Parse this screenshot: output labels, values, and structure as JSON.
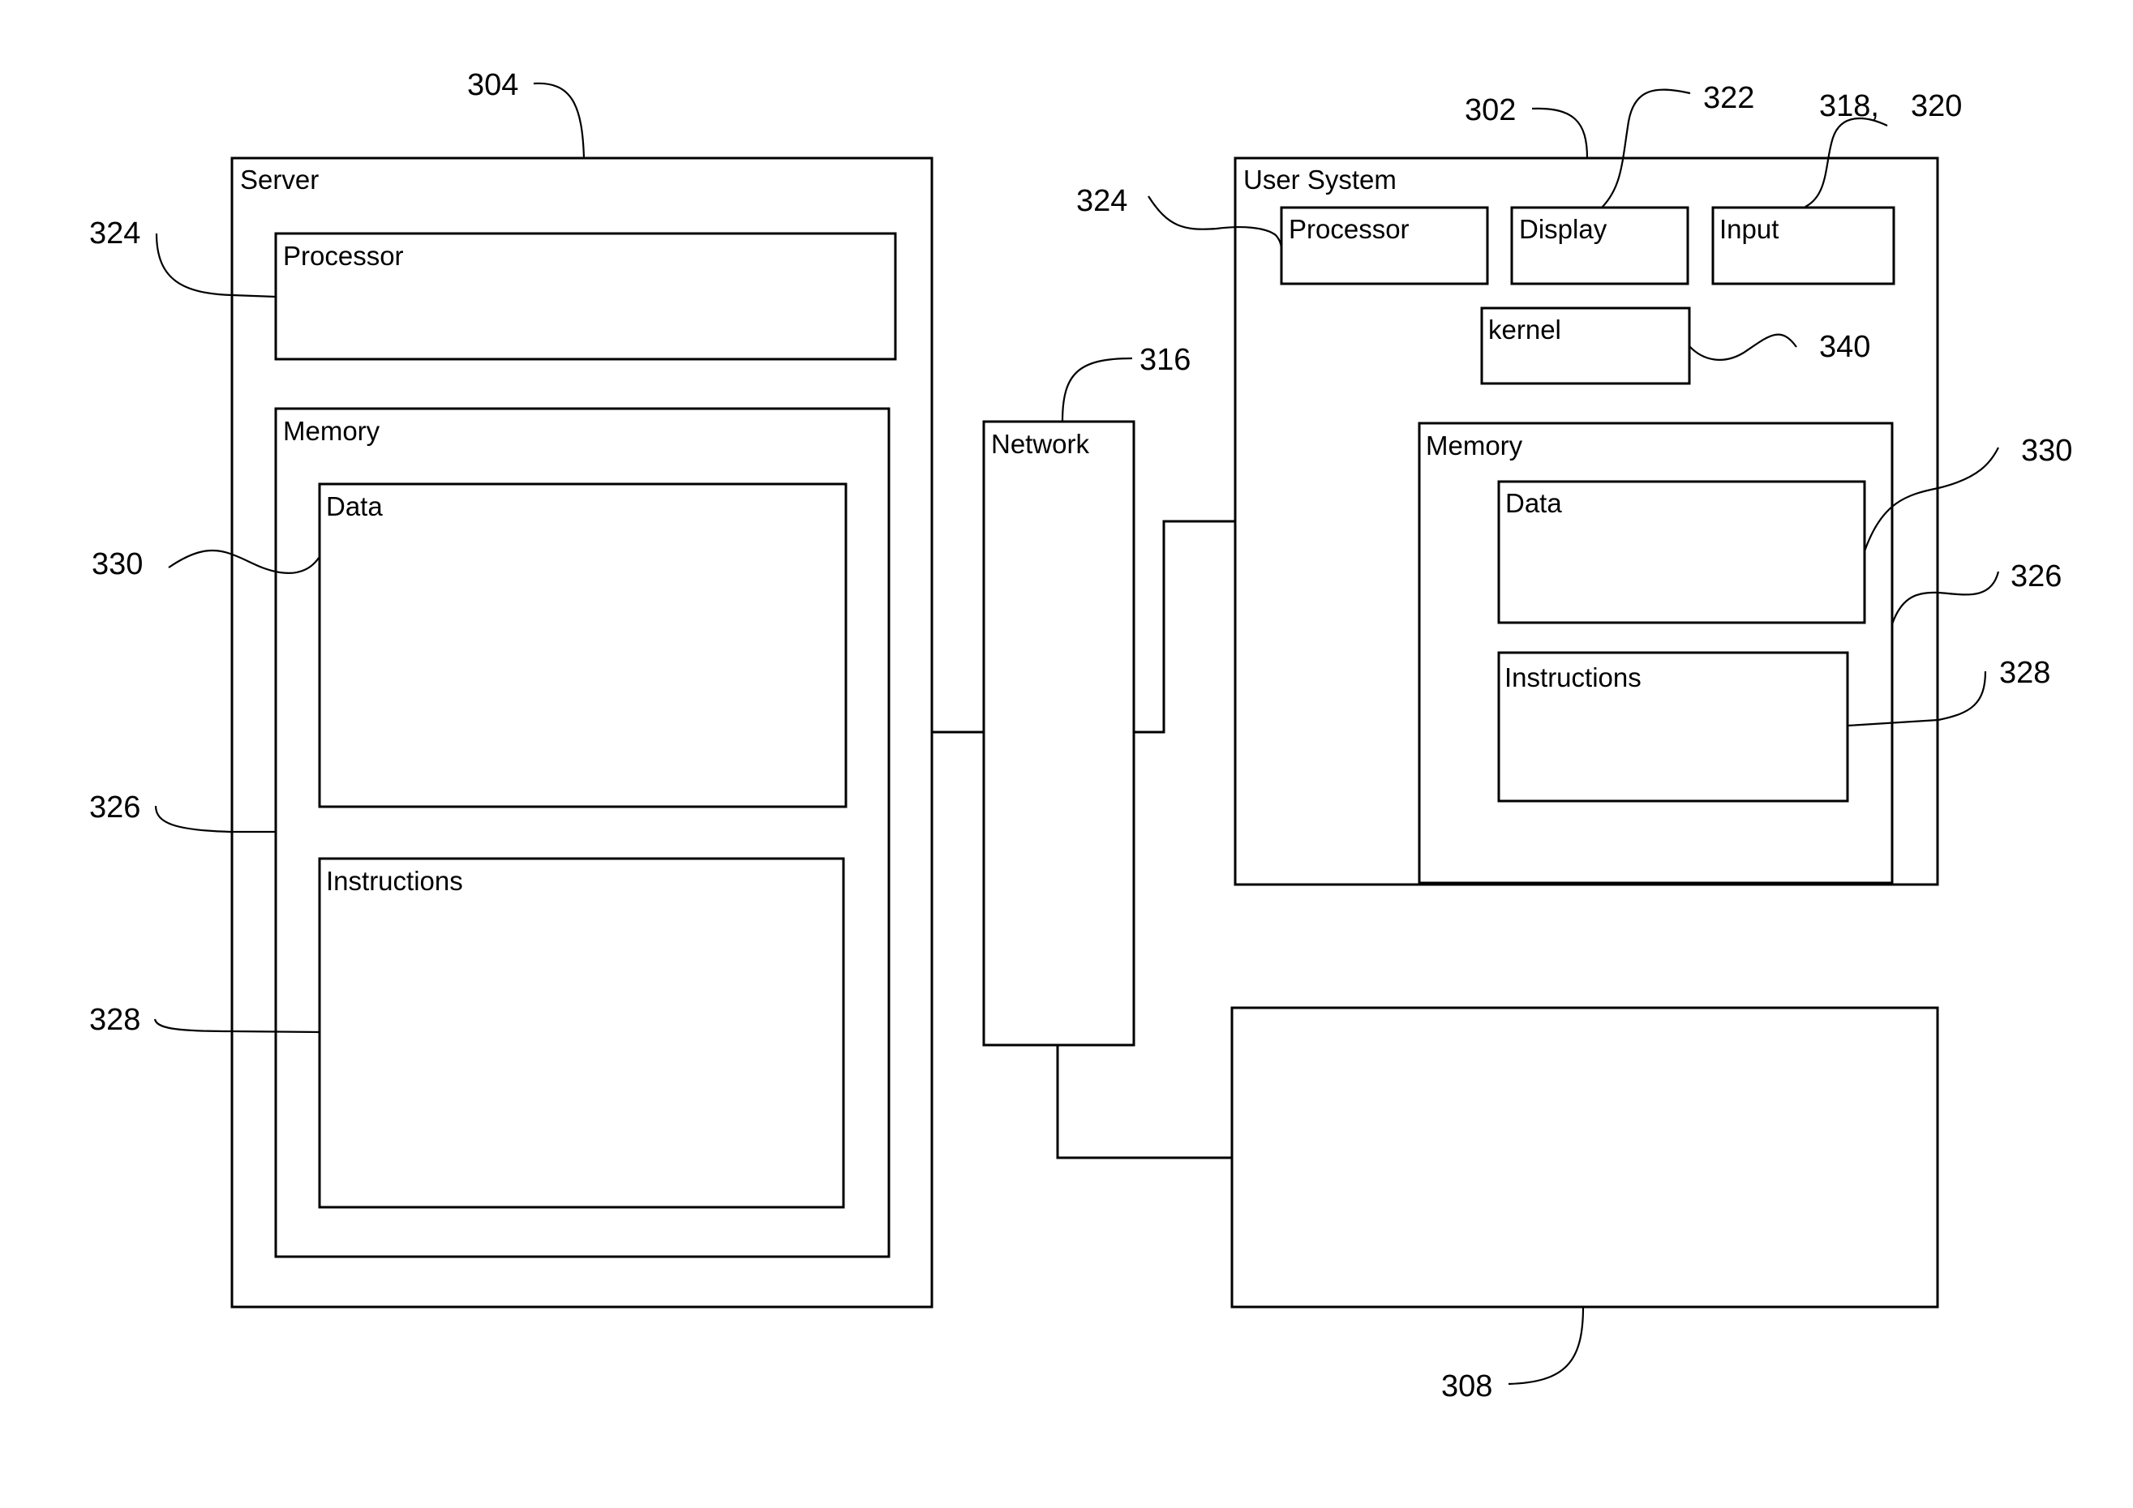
{
  "figure": {
    "type": "block-diagram",
    "background": "#ffffff",
    "line_color": "#000000"
  },
  "server": {
    "label": "Server",
    "ref": "304",
    "processor": {
      "label": "Processor",
      "ref": "324"
    },
    "memory": {
      "label": "Memory",
      "ref": "326"
    },
    "data": {
      "label": "Data",
      "ref": "330"
    },
    "instructions": {
      "label": "Instructions",
      "ref": "328"
    }
  },
  "network": {
    "label": "Network",
    "ref": "316"
  },
  "user_system": {
    "label": "User System",
    "ref": "302",
    "processor": {
      "label": "Processor",
      "ref": "324"
    },
    "display": {
      "label": "Display",
      "ref": "322"
    },
    "input": {
      "label": "Input",
      "ref": "318, 320",
      "ref_a": "318,",
      "ref_b": "320"
    },
    "kernel": {
      "label": "kernel",
      "ref": "340"
    },
    "memory": {
      "label": "Memory",
      "ref": "326"
    },
    "data": {
      "label": "Data",
      "ref": "330"
    },
    "instructions": {
      "label": "Instructions",
      "ref": "328"
    }
  },
  "external_device": {
    "label": "",
    "ref": "308"
  },
  "connections": [
    {
      "from": "server",
      "to": "network"
    },
    {
      "from": "network",
      "to": "user_system"
    },
    {
      "from": "network",
      "to": "external_device"
    }
  ]
}
